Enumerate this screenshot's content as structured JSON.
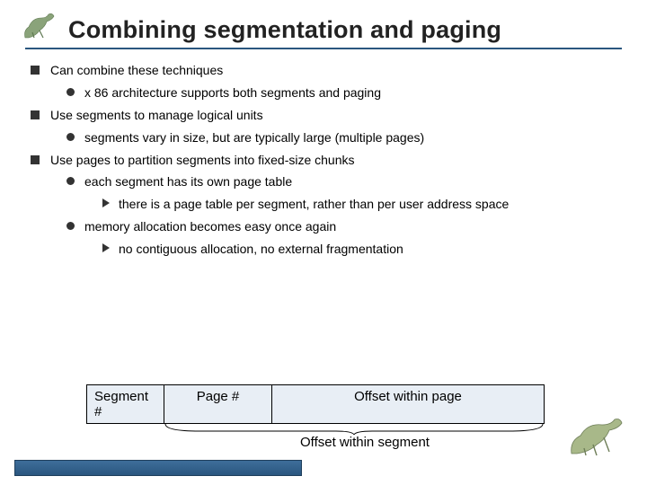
{
  "title": "Combining segmentation and paging",
  "bullets": {
    "b1": "Can combine these techniques",
    "b1a": "x 86 architecture supports both segments and paging",
    "b2": "Use segments to manage logical units",
    "b2a": "segments vary in size, but are typically large (multiple pages)",
    "b3": "Use pages to partition segments into fixed-size chunks",
    "b3a": "each segment has its own page table",
    "b3a1": "there is a page table per segment, rather than per user address space",
    "b3b": "memory allocation becomes easy once again",
    "b3b1": "no contiguous allocation, no external fragmentation"
  },
  "diagram": {
    "segment": "Segment #",
    "page": "Page #",
    "offset_page": "Offset within page",
    "offset_segment": "Offset within segment"
  }
}
